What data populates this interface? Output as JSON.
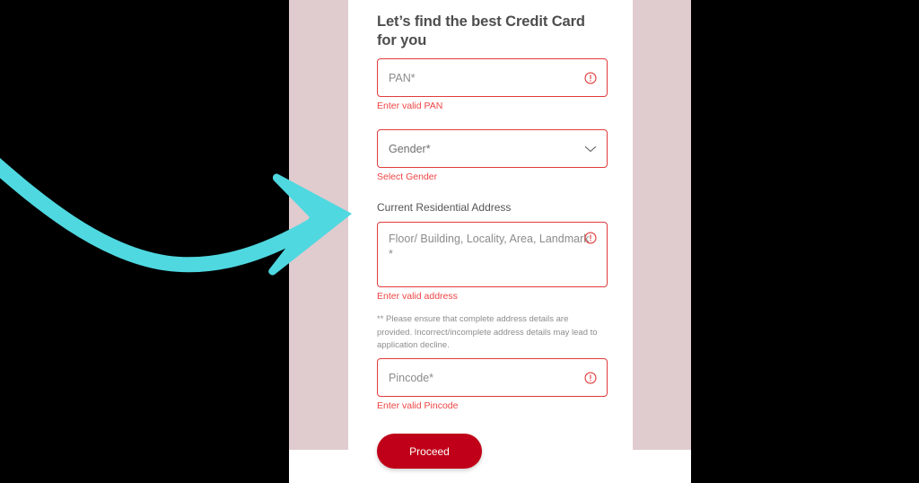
{
  "page": {
    "title": "Let’s find the best Credit Card for you",
    "card_background": "#ffffff",
    "backdrop_band_color": "#e0cbcf",
    "outer_background": "#000000"
  },
  "form": {
    "pan": {
      "placeholder": "PAN*",
      "value": "",
      "error": "Enter valid PAN",
      "error_icon": "exclamation-circle-icon"
    },
    "gender": {
      "placeholder": "Gender*",
      "selected": "Gender*",
      "options": [
        "Gender*"
      ],
      "error": "Select Gender",
      "dropdown_icon": "chevron-down-icon"
    },
    "address": {
      "section_label": "Current Residential Address",
      "placeholder": "Floor/ Building, Locality, Area, Landmark *",
      "value": "",
      "error": "Enter valid address",
      "error_icon": "exclamation-circle-icon",
      "note": "** Please ensure that complete address details are provided. Incorrect/incomplete address details may lead to application decline."
    },
    "pincode": {
      "placeholder": "Pincode*",
      "value": "",
      "error": "Enter valid Pincode",
      "error_icon": "exclamation-circle-icon"
    },
    "submit": {
      "label": "Proceed",
      "color": "#c00018"
    }
  },
  "annotation": {
    "arrow_icon": "curved-arrow-icon",
    "color": "#4fd8e0",
    "points_to": "Current Residential Address"
  },
  "colors": {
    "error_border": "#e23b3b",
    "error_text": "#ef4444",
    "heading_text": "#4d4d4d",
    "placeholder_text": "#8b8b8b",
    "helper_text": "#8d8d8d"
  }
}
